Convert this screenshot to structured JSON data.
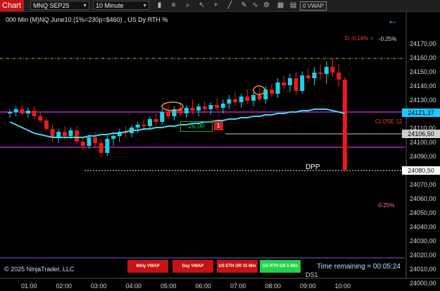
{
  "toolbar": {
    "tab_label": "Chart",
    "instrument": "MNQ SEP25",
    "interval": "10 Minute",
    "vwap_tag": "0 VWAP"
  },
  "chart": {
    "title": "000 Min (M)NQ June10 (1%=230p=$460) , US Dy RTH %",
    "pct_top_red": "D -0.14% =",
    "pct_top_white": "-0.25%",
    "pct_lower": "-0.25%",
    "close_label": "CLOSE 12",
    "dpp_label": "DPP",
    "ds_label": "DS1",
    "position_value": "26,00",
    "position_qty": "1",
    "copyright": "© 2025 NinjaTrader, LLC",
    "time_remaining": "Time remaining = 00:05:24"
  },
  "price_axis": {
    "labels": [
      "24170,00",
      "24160,00",
      "24150,00",
      "24140,00",
      "24130,00",
      "24110,00",
      "24100,00",
      "24090,00",
      "24070,00",
      "24060,00",
      "24050,00",
      "24040,00",
      "24030,00",
      "24020,00",
      "24010,00",
      "24000,00"
    ],
    "flags": [
      {
        "text": "24121,37",
        "bg": "#1ec8ff",
        "fg": "#000"
      },
      {
        "text": "24106,50",
        "bg": "#cfcfcf",
        "fg": "#000"
      },
      {
        "text": "24080,50",
        "bg": "#ffffff",
        "fg": "#000"
      }
    ]
  },
  "time_axis": [
    "01:00",
    "02:00",
    "03:00",
    "04:00",
    "05:00",
    "06:00",
    "07:00",
    "08:00",
    "09:00",
    "10:00"
  ],
  "legend_buttons": [
    {
      "label": "Wkly VWAP",
      "bg": "#c71212"
    },
    {
      "label": "Day VWAP",
      "bg": "#c71212"
    },
    {
      "label": "US ETH OR 15 Min",
      "bg": "#c71212"
    },
    {
      "label": "US RTH OR 5 Min",
      "bg": "#22d14a"
    }
  ],
  "colors": {
    "bull": "#1fd1e6",
    "bear": "#e81c1c",
    "vwap": "#3fd8f0",
    "magenta": "#c21ec2",
    "yellow": "#c9b43a"
  },
  "chart_data": {
    "type": "candlestick",
    "y_range": [
      24000,
      24175
    ],
    "candles": [
      {
        "o": 24121,
        "h": 24124,
        "l": 24118,
        "c": 24122
      },
      {
        "o": 24122,
        "h": 24126,
        "l": 24119,
        "c": 24124
      },
      {
        "o": 24124,
        "h": 24127,
        "l": 24120,
        "c": 24121
      },
      {
        "o": 24121,
        "h": 24125,
        "l": 24118,
        "c": 24123
      },
      {
        "o": 24123,
        "h": 24126,
        "l": 24117,
        "c": 24119
      },
      {
        "o": 24119,
        "h": 24122,
        "l": 24114,
        "c": 24116
      },
      {
        "o": 24116,
        "h": 24118,
        "l": 24108,
        "c": 24110
      },
      {
        "o": 24110,
        "h": 24113,
        "l": 24101,
        "c": 24104
      },
      {
        "o": 24104,
        "h": 24110,
        "l": 24100,
        "c": 24108
      },
      {
        "o": 24108,
        "h": 24112,
        "l": 24103,
        "c": 24105
      },
      {
        "o": 24105,
        "h": 24111,
        "l": 24103,
        "c": 24109
      },
      {
        "o": 24109,
        "h": 24112,
        "l": 24099,
        "c": 24101
      },
      {
        "o": 24101,
        "h": 24104,
        "l": 24095,
        "c": 24098
      },
      {
        "o": 24098,
        "h": 24106,
        "l": 24096,
        "c": 24104
      },
      {
        "o": 24104,
        "h": 24108,
        "l": 24097,
        "c": 24100
      },
      {
        "o": 24100,
        "h": 24103,
        "l": 24090,
        "c": 24093
      },
      {
        "o": 24093,
        "h": 24105,
        "l": 24091,
        "c": 24103
      },
      {
        "o": 24103,
        "h": 24107,
        "l": 24098,
        "c": 24105
      },
      {
        "o": 24105,
        "h": 24110,
        "l": 24101,
        "c": 24108
      },
      {
        "o": 24108,
        "h": 24112,
        "l": 24104,
        "c": 24107
      },
      {
        "o": 24107,
        "h": 24113,
        "l": 24104,
        "c": 24111
      },
      {
        "o": 24111,
        "h": 24115,
        "l": 24107,
        "c": 24113
      },
      {
        "o": 24113,
        "h": 24117,
        "l": 24109,
        "c": 24112
      },
      {
        "o": 24112,
        "h": 24119,
        "l": 24110,
        "c": 24117
      },
      {
        "o": 24117,
        "h": 24121,
        "l": 24112,
        "c": 24115
      },
      {
        "o": 24115,
        "h": 24124,
        "l": 24113,
        "c": 24122
      },
      {
        "o": 24122,
        "h": 24127,
        "l": 24117,
        "c": 24119
      },
      {
        "o": 24119,
        "h": 24126,
        "l": 24116,
        "c": 24124
      },
      {
        "o": 24124,
        "h": 24129,
        "l": 24119,
        "c": 24121
      },
      {
        "o": 24121,
        "h": 24127,
        "l": 24118,
        "c": 24125
      },
      {
        "o": 24125,
        "h": 24131,
        "l": 24120,
        "c": 24123
      },
      {
        "o": 24123,
        "h": 24128,
        "l": 24119,
        "c": 24126
      },
      {
        "o": 24126,
        "h": 24130,
        "l": 24121,
        "c": 24124
      },
      {
        "o": 24124,
        "h": 24129,
        "l": 24120,
        "c": 24127
      },
      {
        "o": 24127,
        "h": 24132,
        "l": 24123,
        "c": 24125
      },
      {
        "o": 24125,
        "h": 24131,
        "l": 24121,
        "c": 24128
      },
      {
        "o": 24128,
        "h": 24134,
        "l": 24124,
        "c": 24131
      },
      {
        "o": 24131,
        "h": 24136,
        "l": 24126,
        "c": 24129
      },
      {
        "o": 24129,
        "h": 24135,
        "l": 24125,
        "c": 24133
      },
      {
        "o": 24133,
        "h": 24138,
        "l": 24128,
        "c": 24130
      },
      {
        "o": 24130,
        "h": 24136,
        "l": 24126,
        "c": 24134
      },
      {
        "o": 24134,
        "h": 24139,
        "l": 24129,
        "c": 24131
      },
      {
        "o": 24131,
        "h": 24140,
        "l": 24128,
        "c": 24138
      },
      {
        "o": 24138,
        "h": 24142,
        "l": 24133,
        "c": 24135
      },
      {
        "o": 24135,
        "h": 24146,
        "l": 24132,
        "c": 24143
      },
      {
        "o": 24143,
        "h": 24148,
        "l": 24138,
        "c": 24141
      },
      {
        "o": 24141,
        "h": 24149,
        "l": 24136,
        "c": 24146
      },
      {
        "o": 24146,
        "h": 24150,
        "l": 24134,
        "c": 24137
      },
      {
        "o": 24137,
        "h": 24151,
        "l": 24135,
        "c": 24148
      },
      {
        "o": 24148,
        "h": 24153,
        "l": 24143,
        "c": 24146
      },
      {
        "o": 24146,
        "h": 24154,
        "l": 24141,
        "c": 24150
      },
      {
        "o": 24150,
        "h": 24156,
        "l": 24145,
        "c": 24149
      },
      {
        "o": 24149,
        "h": 24158,
        "l": 24142,
        "c": 24154
      },
      {
        "o": 24154,
        "h": 24160,
        "l": 24147,
        "c": 24150
      },
      {
        "o": 24150,
        "h": 24156,
        "l": 24140,
        "c": 24145
      },
      {
        "o": 24145,
        "h": 24147,
        "l": 24080,
        "c": 24081
      }
    ],
    "vwap": [
      24115,
      24113,
      24111,
      24109,
      24107,
      24106,
      24105,
      24104,
      24104,
      24104,
      24104,
      24104,
      24104,
      24105,
      24105,
      24106,
      24106,
      24107,
      24107,
      24108,
      24109,
      24109,
      24110,
      24110,
      24111,
      24111,
      24112,
      24112,
      24113,
      24113,
      24114,
      24114,
      24115,
      24115,
      24116,
      24116,
      24117,
      24117,
      24118,
      24118,
      24119,
      24119,
      24120,
      24120,
      24121,
      24121,
      24122,
      24122,
      24123,
      24123,
      24124,
      24124,
      24124,
      24123,
      24122,
      24121
    ],
    "levels": {
      "magenta_upper": 24122,
      "magenta_lower": 24097,
      "yellow": 24160,
      "close": 24106.5,
      "dpp": 24080.5
    }
  }
}
